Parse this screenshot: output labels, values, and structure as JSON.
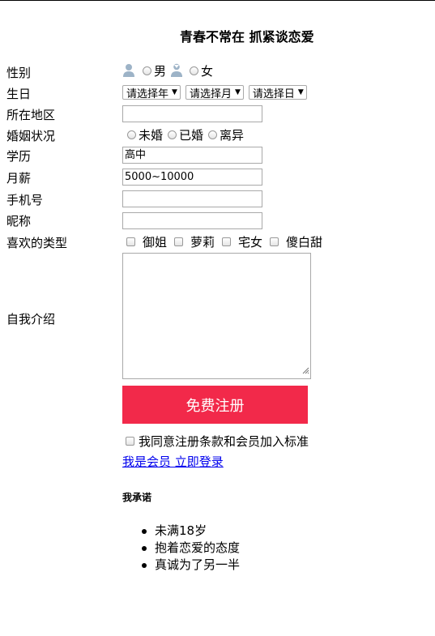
{
  "title": "青春不常在 抓紧谈恋爱",
  "gender": {
    "label": "性别",
    "male": "男",
    "female": "女"
  },
  "birthday": {
    "label": "生日",
    "year": "请选择年",
    "month": "请选择月",
    "day": "请选择日"
  },
  "region": {
    "label": "所在地区",
    "value": ""
  },
  "marital": {
    "label": "婚姻状况",
    "options": [
      "未婚",
      "已婚",
      "离异"
    ]
  },
  "education": {
    "label": "学历",
    "value": "高中"
  },
  "salary": {
    "label": "月薪",
    "value": "5000~10000"
  },
  "phone": {
    "label": "手机号",
    "value": ""
  },
  "nickname": {
    "label": "昵称",
    "value": ""
  },
  "types": {
    "label": "喜欢的类型",
    "options": [
      "御姐",
      "萝莉",
      "宅女",
      "傻白甜"
    ]
  },
  "intro": {
    "label": "自我介绍",
    "value": ""
  },
  "submit": "免费注册",
  "agree": "我同意注册条款和会员加入标准",
  "login_link": "我是会员 立即登录",
  "promise": {
    "heading": "我承诺",
    "items": [
      "未满18岁",
      "抱着恋爱的态度",
      "真诚为了另一半"
    ]
  },
  "colors": {
    "button": "#f2294a",
    "link": "#0000ee",
    "icon": "#9db3c7"
  }
}
